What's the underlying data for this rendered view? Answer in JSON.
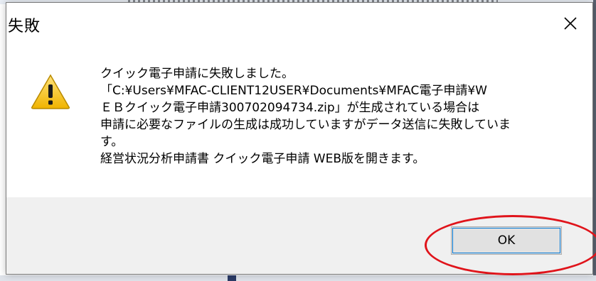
{
  "dialog": {
    "title": "失敗",
    "close_icon": "close-icon",
    "warning_icon": "warning-triangle-icon",
    "message_lines": [
      "クイック電子申請に失敗しました。",
      "「C:¥Users¥MFAC-CLIENT12USER¥Documents¥MFAC電子申請¥W",
      "ＥＢクイック電子申請300702094734.zip」が生成されている場合は",
      "申請に必要なファイルの生成は成功していますがデータ送信に失敗していま",
      "す。",
      "経営状況分析申請書 クイック電子申請 WEB版を開きます。"
    ],
    "ok_label": "OK"
  },
  "colors": {
    "footer_bg": "#f0f0f0",
    "button_bg": "#e1e1e1",
    "focus_outline": "#0078d7",
    "annotation": "#e0141b",
    "warning_yellow": "#f5c518"
  }
}
